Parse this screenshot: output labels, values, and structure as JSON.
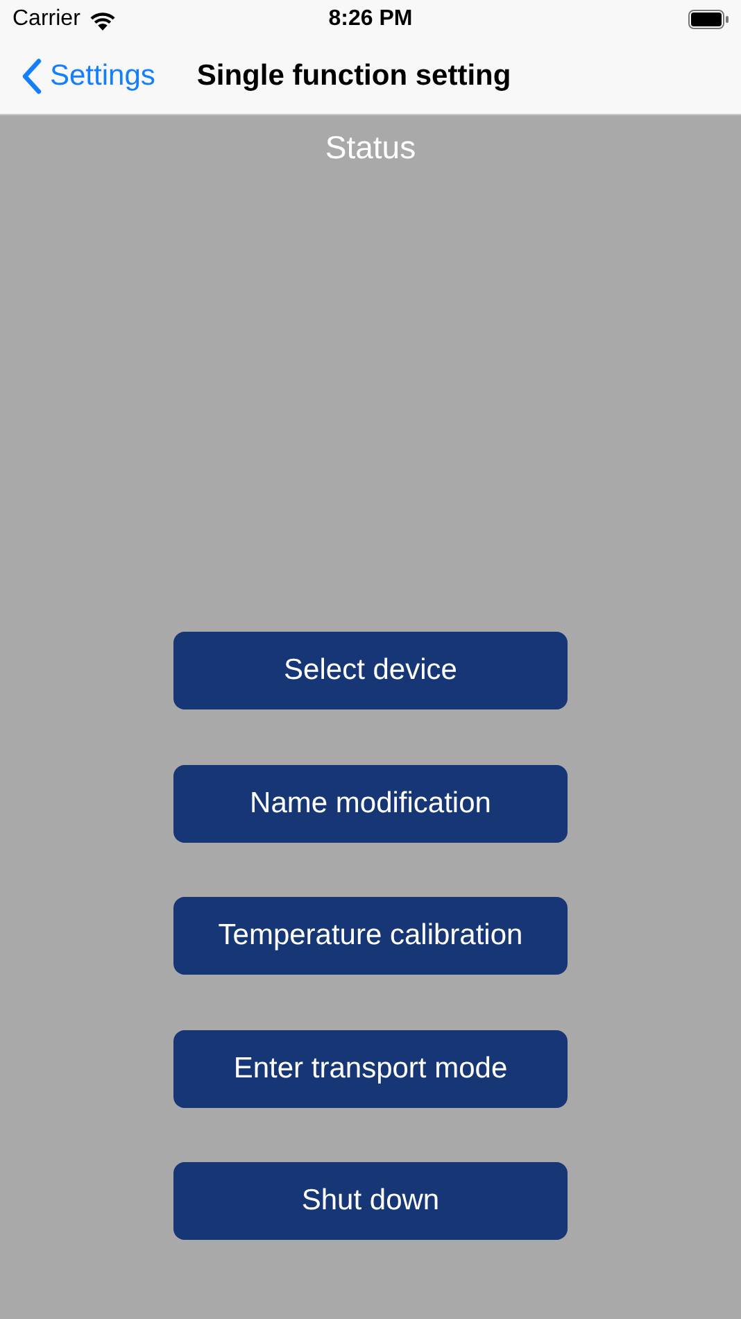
{
  "status_bar": {
    "carrier": "Carrier",
    "time": "8:26 PM"
  },
  "nav_bar": {
    "back": "Settings",
    "title": "Single function setting"
  },
  "status": "Status",
  "buttons": [
    "Select device",
    "Name modification",
    "Temperature calibration",
    "Enter transport mode",
    "Shut down"
  ]
}
